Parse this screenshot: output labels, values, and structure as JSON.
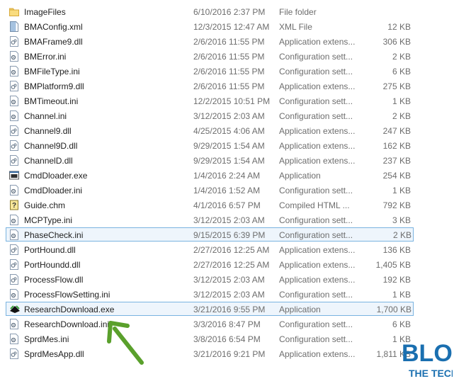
{
  "files": [
    {
      "name": "ImageFiles",
      "date": "6/10/2016 2:37 PM",
      "type": "File folder",
      "size": "",
      "icon": "folder-icon"
    },
    {
      "name": "BMAConfig.xml",
      "date": "12/3/2015 12:47 AM",
      "type": "XML File",
      "size": "12 KB",
      "icon": "xml-file-icon"
    },
    {
      "name": "BMAFrame9.dll",
      "date": "2/6/2016 11:55 PM",
      "type": "Application extens...",
      "size": "306 KB",
      "icon": "dll-file-icon"
    },
    {
      "name": "BMError.ini",
      "date": "2/6/2016 11:55 PM",
      "type": "Configuration sett...",
      "size": "2 KB",
      "icon": "ini-file-icon"
    },
    {
      "name": "BMFileType.ini",
      "date": "2/6/2016 11:55 PM",
      "type": "Configuration sett...",
      "size": "6 KB",
      "icon": "ini-file-icon"
    },
    {
      "name": "BMPlatform9.dll",
      "date": "2/6/2016 11:55 PM",
      "type": "Application extens...",
      "size": "275 KB",
      "icon": "dll-file-icon"
    },
    {
      "name": "BMTimeout.ini",
      "date": "12/2/2015 10:51 PM",
      "type": "Configuration sett...",
      "size": "1 KB",
      "icon": "ini-file-icon"
    },
    {
      "name": "Channel.ini",
      "date": "3/12/2015 2:03 AM",
      "type": "Configuration sett...",
      "size": "2 KB",
      "icon": "ini-file-icon"
    },
    {
      "name": "Channel9.dll",
      "date": "4/25/2015 4:06 AM",
      "type": "Application extens...",
      "size": "247 KB",
      "icon": "dll-file-icon"
    },
    {
      "name": "Channel9D.dll",
      "date": "9/29/2015 1:54 AM",
      "type": "Application extens...",
      "size": "162 KB",
      "icon": "dll-file-icon"
    },
    {
      "name": "ChannelD.dll",
      "date": "9/29/2015 1:54 AM",
      "type": "Application extens...",
      "size": "237 KB",
      "icon": "dll-file-icon"
    },
    {
      "name": "CmdDloader.exe",
      "date": "1/4/2016 2:24 AM",
      "type": "Application",
      "size": "254 KB",
      "icon": "exe-file-icon"
    },
    {
      "name": "CmdDloader.ini",
      "date": "1/4/2016 1:52 AM",
      "type": "Configuration sett...",
      "size": "1 KB",
      "icon": "ini-file-icon"
    },
    {
      "name": "Guide.chm",
      "date": "4/1/2016 6:57 PM",
      "type": "Compiled HTML ...",
      "size": "792 KB",
      "icon": "chm-file-icon"
    },
    {
      "name": "MCPType.ini",
      "date": "3/12/2015 2:03 AM",
      "type": "Configuration sett...",
      "size": "3 KB",
      "icon": "ini-file-icon"
    },
    {
      "name": "PhaseCheck.ini",
      "date": "9/15/2015 6:39 PM",
      "type": "Configuration sett...",
      "size": "2 KB",
      "icon": "ini-file-icon",
      "highlight": true
    },
    {
      "name": "PortHound.dll",
      "date": "2/27/2016 12:25 AM",
      "type": "Application extens...",
      "size": "136 KB",
      "icon": "dll-file-icon"
    },
    {
      "name": "PortHoundd.dll",
      "date": "2/27/2016 12:25 AM",
      "type": "Application extens...",
      "size": "1,405 KB",
      "icon": "dll-file-icon"
    },
    {
      "name": "ProcessFlow.dll",
      "date": "3/12/2015 2:03 AM",
      "type": "Application extens...",
      "size": "192 KB",
      "icon": "dll-file-icon"
    },
    {
      "name": "ProcessFlowSetting.ini",
      "date": "3/12/2015 2:03 AM",
      "type": "Configuration sett...",
      "size": "1 KB",
      "icon": "ini-file-icon"
    },
    {
      "name": "ResearchDownload.exe",
      "date": "3/21/2016 9:55 PM",
      "type": "Application",
      "size": "1,700 KB",
      "icon": "research-download-app-icon",
      "highlight": true
    },
    {
      "name": "ResearchDownload.ini",
      "date": "3/3/2016 8:47 PM",
      "type": "Configuration sett...",
      "size": "6 KB",
      "icon": "ini-file-icon"
    },
    {
      "name": "SprdMes.ini",
      "date": "3/8/2016 6:54 PM",
      "type": "Configuration sett...",
      "size": "1 KB",
      "icon": "ini-file-icon"
    },
    {
      "name": "SprdMesApp.dll",
      "date": "3/21/2016 9:21 PM",
      "type": "Application extens...",
      "size": "1,811 KB",
      "icon": "dll-file-icon"
    }
  ],
  "annotation": {
    "arrow_color": "#5aa02c",
    "arrow_icon": "green-arrow-icon"
  },
  "watermark": {
    "line1": "BLOG",
    "line2": "THE TECH",
    "color": "#1a6fb0"
  }
}
